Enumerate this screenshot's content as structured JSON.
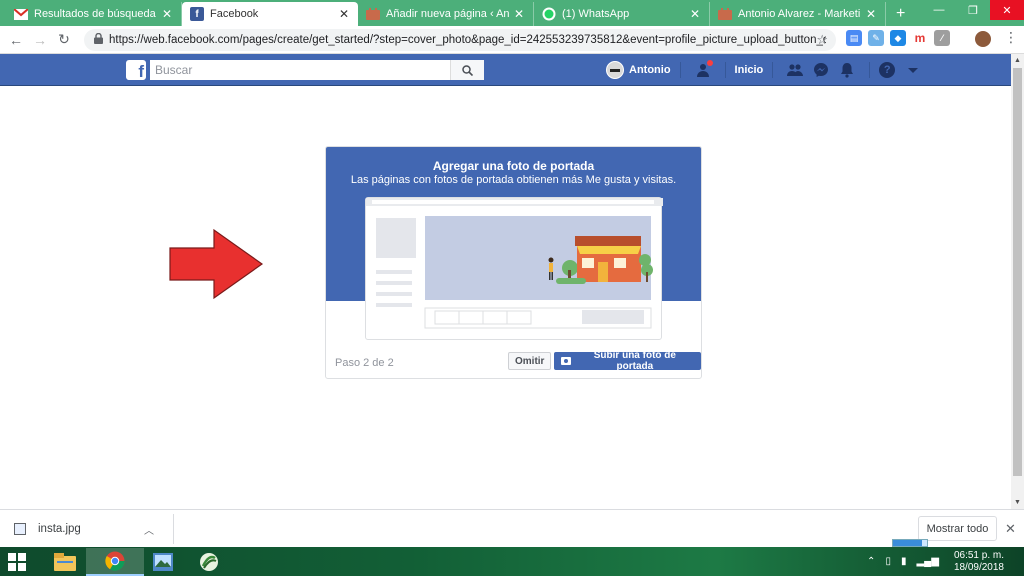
{
  "browser": {
    "tabs": [
      {
        "title": "Resultados de búsqueda - antonio",
        "icon": "gmail-icon",
        "active": false
      },
      {
        "title": "Facebook",
        "icon": "facebook-icon",
        "active": true
      },
      {
        "title": "Añadir nueva página ‹ Antonio Alvarez",
        "icon": "wordpress-icon",
        "active": false
      },
      {
        "title": "(1) WhatsApp",
        "icon": "whatsapp-icon",
        "active": false
      },
      {
        "title": "Antonio Alvarez - Marketing Digital",
        "icon": "wordpress-icon",
        "active": false
      }
    ],
    "new_tab": "+",
    "url": "https://web.facebook.com/pages/create/get_started/?step=cover_photo&page_id=242553239735812&event=profile_picture_upload_button_click",
    "download_progress": 0.85
  },
  "facebook": {
    "logo": "f",
    "search_placeholder": "Buscar",
    "profile_name": "Antonio",
    "home_label": "Inicio",
    "brand_color": "#4267b2"
  },
  "dialog": {
    "title": "Agregar una foto de portada",
    "subtitle": "Las páginas con fotos de portada obtienen más Me gusta y visitas.",
    "step_text": "Paso 2 de 2",
    "skip_label": "Omitir",
    "upload_label": "Subir una foto de portada"
  },
  "annotation": {
    "arrow_color": "#e8302f"
  },
  "downloads": {
    "file_name": "insta.jpg",
    "show_all_label": "Mostrar todo"
  },
  "taskbar": {
    "time": "06:51 p. m.",
    "date": "18/09/2018"
  }
}
